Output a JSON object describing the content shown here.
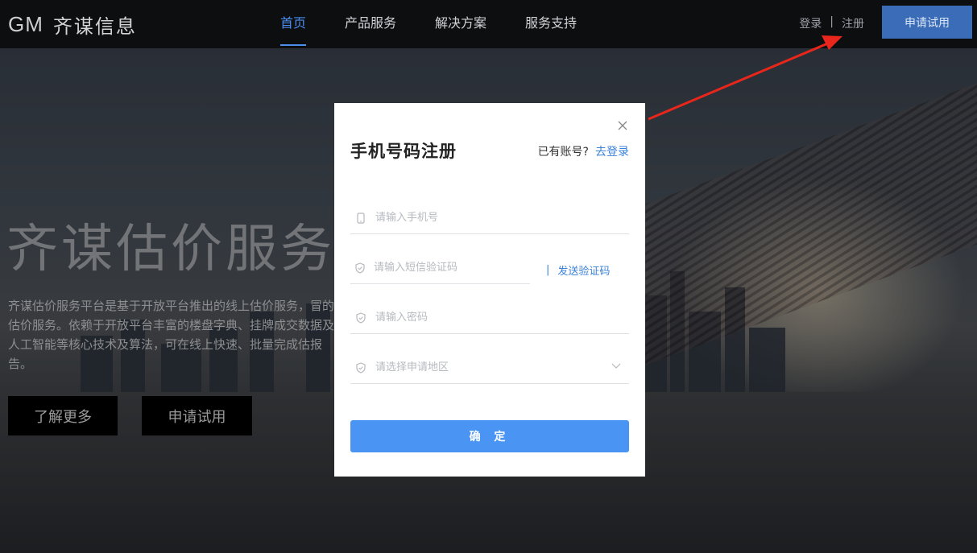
{
  "header": {
    "logo_mark": "GM",
    "logo_text": "齐谋信息",
    "nav": [
      {
        "label": "首页",
        "active": true
      },
      {
        "label": "产品服务",
        "active": false
      },
      {
        "label": "解决方案",
        "active": false
      },
      {
        "label": "服务支持",
        "active": false
      }
    ],
    "login": "登录",
    "separator": "|",
    "register": "注册",
    "apply": "申请试用"
  },
  "hero": {
    "title": "齐谋估价服务平",
    "description": "齐谋估价服务平台是基于开放平台推出的线上估价服务，冒的估价服务。依赖于开放平台丰富的楼盘字典、挂牌成交数据及人工智能等核心技术及算法，可在线上快速、批量完成估报告。",
    "learn_more": "了解更多",
    "apply": "申请试用"
  },
  "modal": {
    "title": "手机号码注册",
    "has_account": "已有账号?",
    "go_login": "去登录",
    "phone_placeholder": "请输入手机号",
    "sms_placeholder": "请输入短信验证码",
    "send_code_sep": "|",
    "send_code": "发送验证码",
    "password_placeholder": "请输入密码",
    "region_placeholder": "请选择申请地区",
    "confirm": "确 定"
  },
  "colors": {
    "accent": "#4a94f4",
    "link": "#3b82d9",
    "nav_active": "#4c8ef0",
    "arrow": "#e8261b"
  }
}
